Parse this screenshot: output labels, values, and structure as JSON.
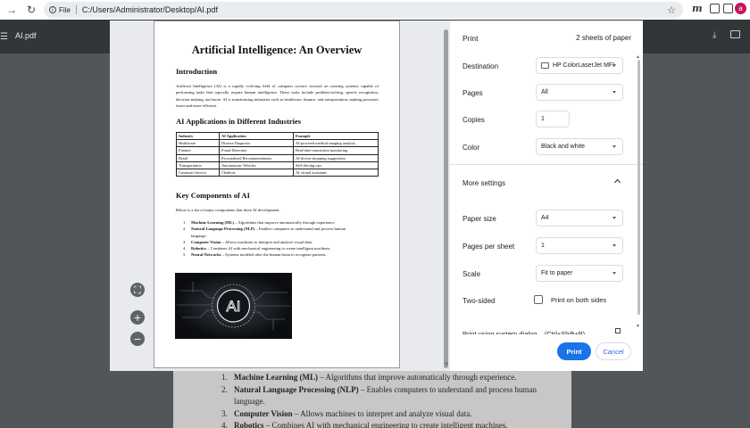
{
  "browser": {
    "site_chip": "File",
    "url": "C:/Users/Administrator/Desktop/AI.pdf",
    "extension_m": "m",
    "avatar_letter": "a"
  },
  "pdf_viewer": {
    "title": "AI.pdf"
  },
  "background_list": [
    {
      "num": "1.",
      "term": "Machine Learning (ML)",
      "text": " – Algorithms that improve automatically through experience."
    },
    {
      "num": "2.",
      "term": "Natural Language Processing (NLP)",
      "text": " – Enables computers to understand and process human"
    },
    {
      "num": "",
      "term": "",
      "text": "language."
    },
    {
      "num": "3.",
      "term": "Computer Vision",
      "text": " – Allows machines to interpret and analyze visual data."
    },
    {
      "num": "4.",
      "term": "Robotics",
      "text": " – Combines AI with mechanical engineering to create intelligent machines."
    }
  ],
  "document": {
    "title": "Artificial Intelligence: An Overview",
    "intro_heading": "Introduction",
    "intro_text": "Artificial Intelligence (AI) is a rapidly evolving field of computer science focused on creating systems capable of performing tasks that typically require human intelligence. These tasks include problem-solving, speech recognition, decision-making, and more. AI is transforming industries such as healthcare, finance, and transportation, making processes faster and more efficient.",
    "apps_heading": "AI Applications in Different Industries",
    "table_headers": [
      "Industry",
      "AI Application",
      "Example"
    ],
    "table_rows": [
      [
        "Healthcare",
        "Disease Diagnosis",
        "AI-powered medical imaging analysis"
      ],
      [
        "Finance",
        "Fraud Detection",
        "Real-time transaction monitoring"
      ],
      [
        "Retail",
        "Personalized Recommendations",
        "AI-driven shopping suggestions"
      ],
      [
        "Transportation",
        "Autonomous Vehicles",
        "Self-driving cars"
      ],
      [
        "Customer Service",
        "Chatbots",
        "AI virtual assistants"
      ]
    ],
    "components_heading": "Key Components of AI",
    "components_intro": "Below is a list of major components that drive AI development:",
    "components": [
      {
        "num": "1.",
        "term": "Machine Learning (ML)",
        "text": " – Algorithms that improve automatically through experience."
      },
      {
        "num": "2.",
        "term": "Natural Language Processing (NLP)",
        "text": " – Enables computers to understand and process human"
      },
      {
        "num": "",
        "term": "",
        "text": "language."
      },
      {
        "num": "3.",
        "term": "Computer Vision",
        "text": " – Allows machines to interpret and analyze visual data."
      },
      {
        "num": "4.",
        "term": "Robotics",
        "text": " – Combines AI with mechanical engineering to create intelligent machines."
      },
      {
        "num": "5.",
        "term": "Neural Networks",
        "text": " – Systems modeled after the human brain to recognize patterns."
      }
    ],
    "image_text": "AI"
  },
  "print_settings": {
    "title": "Print",
    "sheets": "2 sheets of paper",
    "destination_label": "Destination",
    "destination_value": "HP ColorLaserJet MFI",
    "pages_label": "Pages",
    "pages_value": "All",
    "copies_label": "Copies",
    "copies_value": "1",
    "color_label": "Color",
    "color_value": "Black and white",
    "more_settings_label": "More settings",
    "paper_size_label": "Paper size",
    "paper_size_value": "A4",
    "pages_per_sheet_label": "Pages per sheet",
    "pages_per_sheet_value": "1",
    "scale_label": "Scale",
    "scale_value": "Fit to paper",
    "two_sided_label": "Two-sided",
    "two_sided_option": "Print on both sides",
    "system_dialog_label": "Print using system dialog... (Ctrl+Shift+P)",
    "print_button": "Print",
    "cancel_button": "Cancel"
  },
  "colors": {
    "accent": "#1a73e8",
    "viewer_bg": "#525659",
    "toolbar_dark": "#323639",
    "avatar": "#c2185b"
  }
}
